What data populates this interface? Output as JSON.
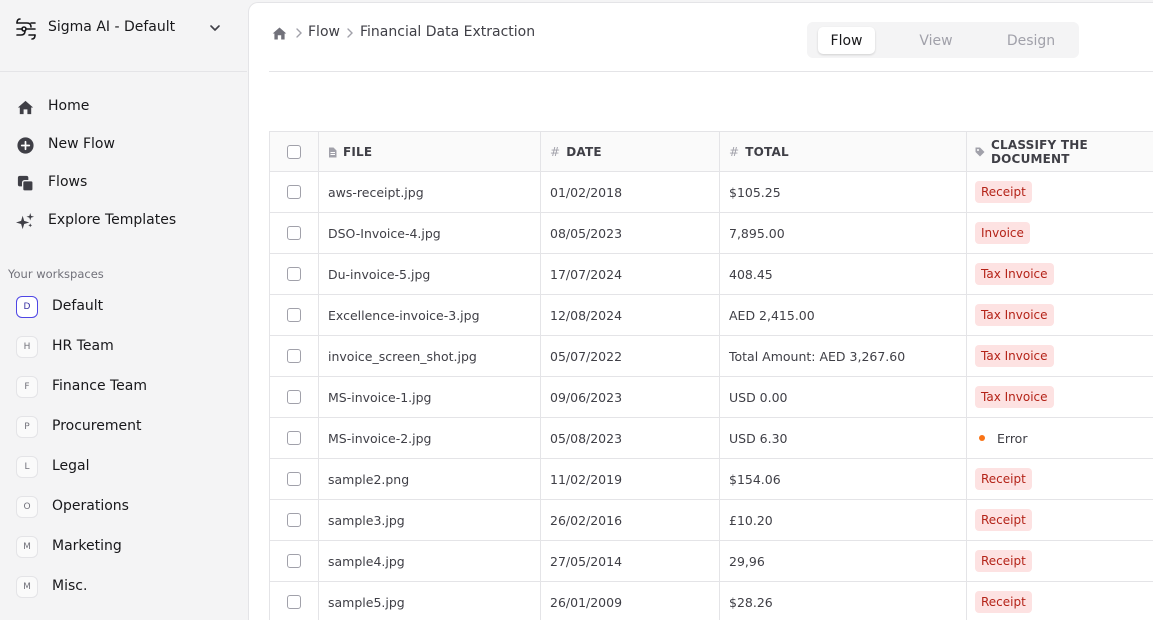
{
  "workspace": {
    "name": "Sigma AI - Default"
  },
  "nav": [
    {
      "id": "home",
      "label": "Home",
      "icon": "home-icon"
    },
    {
      "id": "new-flow",
      "label": "New Flow",
      "icon": "plus-circle-icon"
    },
    {
      "id": "flows",
      "label": "Flows",
      "icon": "copy-icon"
    },
    {
      "id": "explore-templates",
      "label": "Explore Templates",
      "icon": "sparkle-icon"
    }
  ],
  "workspaces_heading": "Your workspaces",
  "workspaces": [
    {
      "initial": "D",
      "label": "Default",
      "active": true
    },
    {
      "initial": "H",
      "label": "HR Team"
    },
    {
      "initial": "F",
      "label": "Finance Team"
    },
    {
      "initial": "P",
      "label": "Procurement"
    },
    {
      "initial": "L",
      "label": "Legal"
    },
    {
      "initial": "O",
      "label": "Operations"
    },
    {
      "initial": "M",
      "label": "Marketing"
    },
    {
      "initial": "M",
      "label": "Misc."
    }
  ],
  "breadcrumb": [
    "Flow",
    "Financial Data Extraction"
  ],
  "view_tabs": [
    {
      "label": "Flow",
      "active": true
    },
    {
      "label": "View"
    },
    {
      "label": "Design"
    }
  ],
  "table": {
    "columns": [
      {
        "icon": "file-icon",
        "label": "FILE"
      },
      {
        "icon": "hash-icon",
        "label": "DATE"
      },
      {
        "icon": "hash-icon",
        "label": "TOTAL"
      },
      {
        "icon": "tag-icon",
        "label": "CLASSIFY THE DOCUMENT"
      }
    ],
    "rows": [
      {
        "file": "aws-receipt.jpg",
        "date": "01/02/2018",
        "total": "$105.25",
        "class": "Receipt"
      },
      {
        "file": "DSO-Invoice-4.jpg",
        "date": "08/05/2023",
        "total": "7,895.00",
        "class": "Invoice"
      },
      {
        "file": "Du-invoice-5.jpg",
        "date": "17/07/2024",
        "total": "408.45",
        "class": "Tax Invoice"
      },
      {
        "file": "Excellence-invoice-3.jpg",
        "date": "12/08/2024",
        "total": "AED 2,415.00",
        "class": "Tax Invoice"
      },
      {
        "file": "invoice_screen_shot.jpg",
        "date": "05/07/2022",
        "total": "Total Amount: AED 3,267.60",
        "class": "Tax Invoice"
      },
      {
        "file": "MS-invoice-1.jpg",
        "date": "09/06/2023",
        "total": "USD 0.00",
        "class": "Tax Invoice"
      },
      {
        "file": "MS-invoice-2.jpg",
        "date": "05/08/2023",
        "total": "USD 6.30",
        "class": "Error",
        "error": true
      },
      {
        "file": "sample2.png",
        "date": "11/02/2019",
        "total": "$154.06",
        "class": "Receipt"
      },
      {
        "file": "sample3.jpg",
        "date": "26/02/2016",
        "total": "£10.20",
        "class": "Receipt"
      },
      {
        "file": "sample4.jpg",
        "date": "27/05/2014",
        "total": "29,96",
        "class": "Receipt"
      },
      {
        "file": "sample5.jpg",
        "date": "26/01/2009",
        "total": "$28.26",
        "class": "Receipt"
      }
    ]
  },
  "colors": {
    "accent": "#4f46e5",
    "tag_bg": "#fde2e2",
    "tag_text": "#b42318",
    "error_dot": "#f97316"
  }
}
